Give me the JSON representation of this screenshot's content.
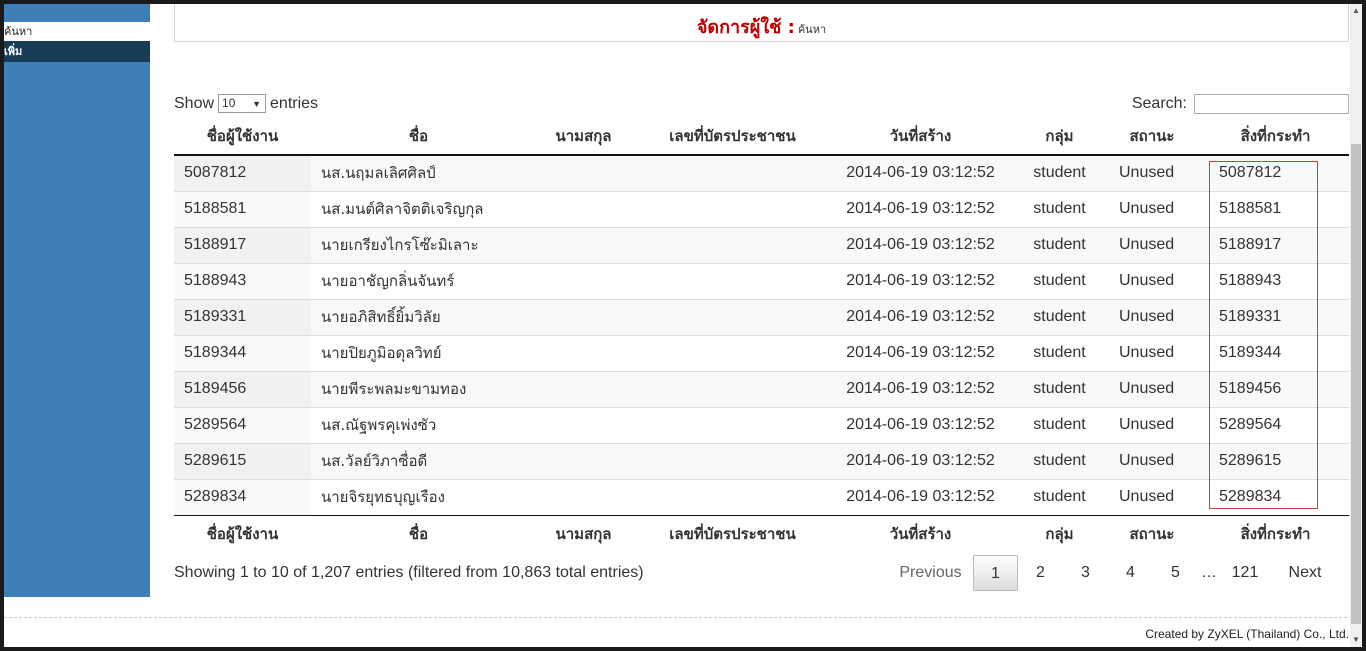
{
  "sidebar": {
    "search_label": "ค้นหา",
    "add_label": "เพิ่ม"
  },
  "header": {
    "title": "จัดการผู้ใช้ :",
    "subtitle": "ค้นหา"
  },
  "controls": {
    "show_label": "Show",
    "entries_value": "10",
    "entries_label": "entries",
    "search_label": "Search:",
    "search_value": ""
  },
  "table": {
    "columns": [
      "ชื่อผู้ใช้งาน",
      "ชื่อ",
      "นามสกุล",
      "เลขที่บัตรประชาชน",
      "วันที่สร้าง",
      "กลุ่ม",
      "สถานะ",
      "สิ่งที่กระทำ"
    ],
    "rows": [
      {
        "username": "5087812",
        "name": "นส.นฤมลเลิศศิลป์",
        "lastname": "",
        "idcard": "",
        "created": "2014-06-19 03:12:52",
        "group": "student",
        "status": "Unused",
        "action": "5087812"
      },
      {
        "username": "5188581",
        "name": "นส.มนต์ศิลาจิตติเจริญกุล",
        "lastname": "",
        "idcard": "",
        "created": "2014-06-19 03:12:52",
        "group": "student",
        "status": "Unused",
        "action": "5188581"
      },
      {
        "username": "5188917",
        "name": "นายเกรียงไกรโซ๊ะมิเลาะ",
        "lastname": "",
        "idcard": "",
        "created": "2014-06-19 03:12:52",
        "group": "student",
        "status": "Unused",
        "action": "5188917"
      },
      {
        "username": "5188943",
        "name": "นายอาชัญกลิ่นจันทร์",
        "lastname": "",
        "idcard": "",
        "created": "2014-06-19 03:12:52",
        "group": "student",
        "status": "Unused",
        "action": "5188943"
      },
      {
        "username": "5189331",
        "name": "นายอภิสิทธิ์ยิ้มวิลัย",
        "lastname": "",
        "idcard": "",
        "created": "2014-06-19 03:12:52",
        "group": "student",
        "status": "Unused",
        "action": "5189331"
      },
      {
        "username": "5189344",
        "name": "นายปิยภูมิอดุลวิทย์",
        "lastname": "",
        "idcard": "",
        "created": "2014-06-19 03:12:52",
        "group": "student",
        "status": "Unused",
        "action": "5189344"
      },
      {
        "username": "5189456",
        "name": "นายพีระพลมะขามทอง",
        "lastname": "",
        "idcard": "",
        "created": "2014-06-19 03:12:52",
        "group": "student",
        "status": "Unused",
        "action": "5189456"
      },
      {
        "username": "5289564",
        "name": "นส.ณัฐพรคุเพ่งซัว",
        "lastname": "",
        "idcard": "",
        "created": "2014-06-19 03:12:52",
        "group": "student",
        "status": "Unused",
        "action": "5289564"
      },
      {
        "username": "5289615",
        "name": "นส.วัลย์วิภาซื่อดี",
        "lastname": "",
        "idcard": "",
        "created": "2014-06-19 03:12:52",
        "group": "student",
        "status": "Unused",
        "action": "5289615"
      },
      {
        "username": "5289834",
        "name": "นายจิรยุทธบุญเรือง",
        "lastname": "",
        "idcard": "",
        "created": "2014-06-19 03:12:52",
        "group": "student",
        "status": "Unused",
        "action": "5289834"
      }
    ]
  },
  "info": "Showing 1 to 10 of 1,207 entries (filtered from 10,863 total entries)",
  "pagination": {
    "previous": "Previous",
    "pages": [
      "1",
      "2",
      "3",
      "4",
      "5"
    ],
    "ellipsis": "…",
    "last": "121",
    "next": "Next",
    "current": "1"
  },
  "footer": {
    "credit": "Created by ZyXEL (Thailand) Co., Ltd."
  },
  "colors": {
    "sidebar": "#3d7fb6",
    "sidebar_active": "#163d55",
    "title": "#c00000",
    "highlight_box": "#d23c3c"
  }
}
